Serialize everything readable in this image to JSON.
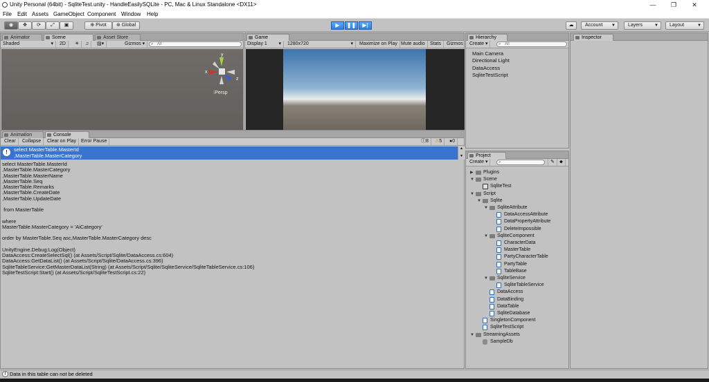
{
  "window": {
    "title": "Unity Personal (64bit) - SqliteTest.unity - HandleEasilySQLite - PC, Mac & Linux Standalone <DX11>",
    "minimize": "—",
    "maximize": "❐",
    "close": "✕"
  },
  "menu": [
    "File",
    "Edit",
    "Assets",
    "GameObject",
    "Component",
    "Window",
    "Help"
  ],
  "toolbar": {
    "pivot": "Pivot",
    "global": "Global",
    "account": "Account",
    "layers": "Layers",
    "layout": "Layout"
  },
  "scene": {
    "tabs": [
      "Animator",
      "Scene",
      "Asset Store"
    ],
    "shaded": "Shaded",
    "mode2d": "2D",
    "gizmos": "Gizmos",
    "search_placeholder": "All",
    "gizmo": {
      "x": "x",
      "y": "y",
      "z": "z"
    },
    "persp": "Persp"
  },
  "game": {
    "tab": "Game",
    "display": "Display 1",
    "resolution": "1280x720",
    "maximize": "Maximize on Play",
    "mute": "Mute audio",
    "stats": "Stats",
    "gizmos": "Gizmos"
  },
  "hierarchy": {
    "tab": "Hierarchy",
    "create": "Create",
    "search_placeholder": "All",
    "items": [
      "Main Camera",
      "Directional Light",
      "DataAccess",
      "SqliteTestScript"
    ]
  },
  "inspector": {
    "tab": "Inspector"
  },
  "console": {
    "tabs": [
      "Animation",
      "Console"
    ],
    "buttons": [
      "Clear",
      "Collapse",
      "Clear on Play",
      "Error Pause"
    ],
    "counts": {
      "logs": "8",
      "warnings": "5",
      "errors": "0"
    },
    "selected": [
      "select MasterTable.MasterId",
      ",MasterTable.MasterCategory"
    ],
    "body": "select MasterTable.MasterId\n,MasterTable.MasterCategory\n,MasterTable.MasterName\n,MasterTable.Seq\n,MasterTable.Remarks\n,MasterTable.CreateDate\n,MasterTable.UpdateDate\n\n from MasterTable\n\nwhere\nMasterTable.MasterCategory = 'AiCategory'\n\norder by MasterTable.Seq asc,MasterTable.MasterCategory desc\n\nUnityEngine.Debug:Log(Object)\nDataAccess:CreateSelectSql() (at Assets/Script/Sqlite/DataAccess.cs:604)\nDataAccess:GetDataList() (at Assets/Script/Sqlite/DataAccess.cs:396)\nSqliteTableService:GetMasterDataList(String) (at Assets/Script/Sqlite/SqliteService/SqliteTableService.cs:106)\nSqliteTestScript:Start() (at Assets/Script/SqliteTestScript.cs:22)"
  },
  "project": {
    "tab": "Project",
    "create": "Create",
    "tree": [
      {
        "label": "Plugins",
        "depth": 0,
        "icon": "folder",
        "arrow": "▶"
      },
      {
        "label": "Scene",
        "depth": 0,
        "icon": "folder",
        "arrow": "▼"
      },
      {
        "label": "SqliteTest",
        "depth": 1,
        "icon": "unity"
      },
      {
        "label": "Script",
        "depth": 0,
        "icon": "folder",
        "arrow": "▼"
      },
      {
        "label": "Sqlite",
        "depth": 1,
        "icon": "folder",
        "arrow": "▼"
      },
      {
        "label": "SqliteAttribute",
        "depth": 2,
        "icon": "folder",
        "arrow": "▼"
      },
      {
        "label": "DataAccessAttribute",
        "depth": 3,
        "icon": "script"
      },
      {
        "label": "DataPropertyAttribute",
        "depth": 3,
        "icon": "script"
      },
      {
        "label": "DeleteImpossible",
        "depth": 3,
        "icon": "script"
      },
      {
        "label": "SqliteComponent",
        "depth": 2,
        "icon": "folder",
        "arrow": "▼"
      },
      {
        "label": "CharacterData",
        "depth": 3,
        "icon": "script"
      },
      {
        "label": "MasterTable",
        "depth": 3,
        "icon": "script"
      },
      {
        "label": "PartyCharacterTable",
        "depth": 3,
        "icon": "script"
      },
      {
        "label": "PartyTable",
        "depth": 3,
        "icon": "script"
      },
      {
        "label": "TableBase",
        "depth": 3,
        "icon": "script"
      },
      {
        "label": "SqliteService",
        "depth": 2,
        "icon": "folder",
        "arrow": "▼"
      },
      {
        "label": "SqliteTableService",
        "depth": 3,
        "icon": "script"
      },
      {
        "label": "DataAccess",
        "depth": 2,
        "icon": "script"
      },
      {
        "label": "DataBinding",
        "depth": 2,
        "icon": "script"
      },
      {
        "label": "DataTable",
        "depth": 2,
        "icon": "script"
      },
      {
        "label": "SqliteDatabase",
        "depth": 2,
        "icon": "script"
      },
      {
        "label": "SingletonComponent",
        "depth": 1,
        "icon": "script"
      },
      {
        "label": "SqliteTestScript",
        "depth": 1,
        "icon": "script"
      },
      {
        "label": "StreamingAssets",
        "depth": 0,
        "icon": "folder",
        "arrow": "▼"
      },
      {
        "label": "SampleDb",
        "depth": 1,
        "icon": "db"
      }
    ]
  },
  "status": {
    "message": "Data in this table can not be deleted"
  },
  "colors": {
    "selection": "#3a72d0",
    "play": "#2f7fe6"
  }
}
